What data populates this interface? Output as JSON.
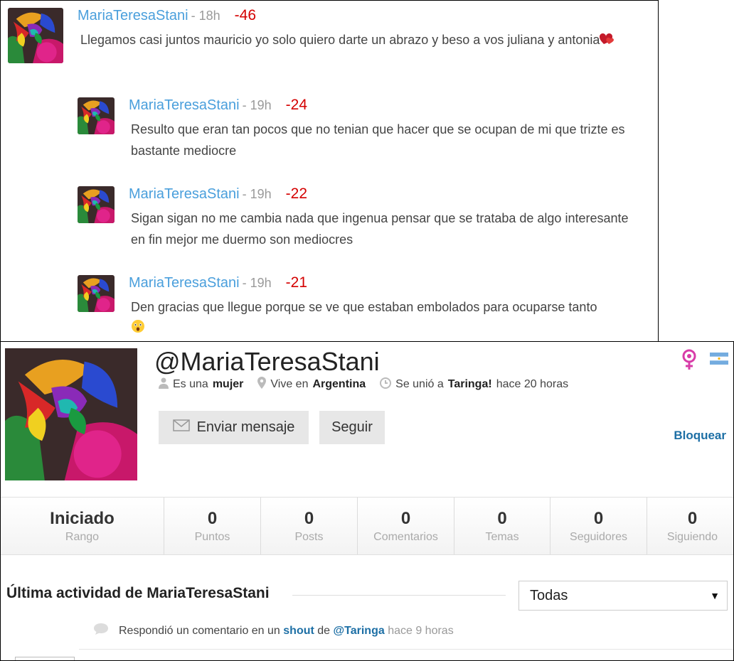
{
  "comments": [
    {
      "user": "MariaTeresaStani",
      "time": "- 18h",
      "score": "-46",
      "text": "Llegamos casi juntos mauricio yo solo quiero darte un abrazo y beso a vos juliana y antonia",
      "emoji": "heart-icon"
    },
    {
      "user": "MariaTeresaStani",
      "time": "- 19h",
      "score": "-24",
      "text": "Resulto que eran tan pocos que no tenian que hacer que se ocupan de mi que trizte es bastante mediocre"
    },
    {
      "user": "MariaTeresaStani",
      "time": "- 19h",
      "score": "-22",
      "text": "Sigan sigan no me cambia nada que ingenua pensar que se trataba de algo interesante en fin mejor me duermo son mediocres"
    },
    {
      "user": "MariaTeresaStani",
      "time": "- 19h",
      "score": "-21",
      "text": "Den gracias que llegue porque se ve que estaban embolados para ocuparse tanto",
      "emoji": "astonished-face-icon"
    }
  ],
  "profile": {
    "handle": "@MariaTeresaStani",
    "gender_prefix": "Es una",
    "gender": "mujer",
    "location_prefix": "Vive en",
    "location": "Argentina",
    "joined_prefix": "Se unió a",
    "site": "Taringa!",
    "joined_ago": "hace 20 horas",
    "send_message": "Enviar mensaje",
    "follow": "Seguir",
    "block": "Bloquear"
  },
  "stats": [
    {
      "value": "Iniciado",
      "label": "Rango"
    },
    {
      "value": "0",
      "label": "Puntos"
    },
    {
      "value": "0",
      "label": "Posts"
    },
    {
      "value": "0",
      "label": "Comentarios"
    },
    {
      "value": "0",
      "label": "Temas"
    },
    {
      "value": "0",
      "label": "Seguidores"
    },
    {
      "value": "0",
      "label": "Siguiendo"
    }
  ],
  "activity": {
    "title": "Última actividad de MariaTeresaStani",
    "filter": "Todas",
    "item": {
      "text_a": "Respondió un comentario en un",
      "link_a": "shout",
      "text_b": "de",
      "link_b": "@Taringa",
      "ago": "hace 9 horas"
    }
  },
  "colors": {
    "username": "#4a9fdc",
    "score": "#d40000",
    "link": "#1d6fa5"
  }
}
